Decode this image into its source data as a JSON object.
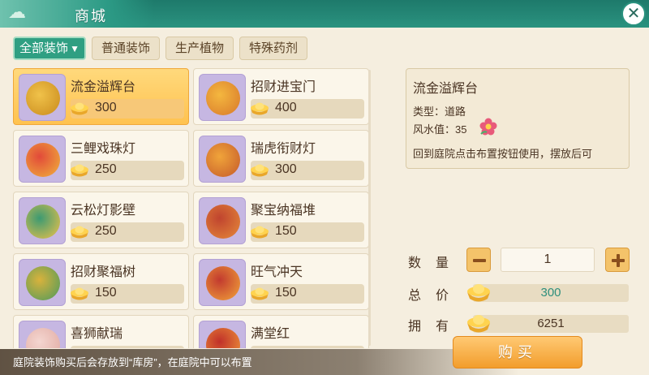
{
  "window": {
    "title": "商城",
    "close_symbol": "✕"
  },
  "tabs": [
    {
      "label": "全部装饰",
      "active": true
    },
    {
      "label": "普通装饰",
      "active": false
    },
    {
      "label": "生产植物",
      "active": false
    },
    {
      "label": "特殊药剂",
      "active": false
    }
  ],
  "items": [
    {
      "name": "流金溢辉台",
      "price": "300",
      "selected": true
    },
    {
      "name": "招财进宝门",
      "price": "400",
      "selected": false
    },
    {
      "name": "三鲤戏珠灯",
      "price": "250",
      "selected": false
    },
    {
      "name": "瑞虎衔财灯",
      "price": "300",
      "selected": false
    },
    {
      "name": "云松灯影壁",
      "price": "250",
      "selected": false
    },
    {
      "name": "聚宝纳福堆",
      "price": "150",
      "selected": false
    },
    {
      "name": "招财聚福树",
      "price": "150",
      "selected": false
    },
    {
      "name": "旺气冲天",
      "price": "150",
      "selected": false
    },
    {
      "name": "喜狮献瑞",
      "price": "",
      "selected": false
    },
    {
      "name": "满堂红",
      "price": "",
      "selected": false
    }
  ],
  "detail": {
    "name": "流金溢辉台",
    "type": "类型：道路",
    "fengshui": "风水值：35",
    "description": "回到庭院点击布置按钮使用，摆放后可"
  },
  "purchase": {
    "qty_label": "数量",
    "qty": "1",
    "total_label": "总价",
    "total": "300",
    "owned_label": "拥有",
    "owned": "6251",
    "buy_label": "购买"
  },
  "footer": {
    "text": "庭院装饰购买后会存放到“库房”，在庭院中可以布置"
  },
  "colors": {
    "accent_green": "#2f9f82",
    "selected_gold": "#ffc24f",
    "total_text": "#2f8f7c"
  }
}
